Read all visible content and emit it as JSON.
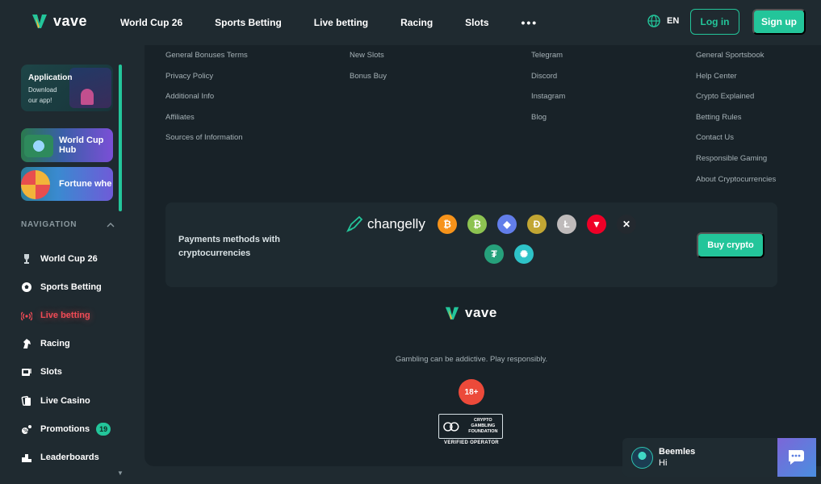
{
  "header": {
    "logo_text": "vave",
    "nav": [
      "World Cup 26",
      "Sports Betting",
      "Live betting",
      "Racing",
      "Slots"
    ],
    "more": "•••",
    "language": "EN",
    "login_label": "Log in",
    "signup_label": "Sign up"
  },
  "sidebar": {
    "promo_app": {
      "title": "Application",
      "subtitle": "Download our app!"
    },
    "promo_worldcup": {
      "title": "World Cup Hub"
    },
    "promo_fortune": {
      "title": "Fortune whe"
    },
    "nav_heading": "NAVIGATION",
    "nav_items": [
      {
        "label": "World Cup 26",
        "icon": "trophy-icon"
      },
      {
        "label": "Sports Betting",
        "icon": "soccer-ball-icon"
      },
      {
        "label": "Live betting",
        "icon": "live-broadcast-icon"
      },
      {
        "label": "Racing",
        "icon": "horse-icon"
      },
      {
        "label": "Slots",
        "icon": "slot-machine-icon"
      },
      {
        "label": "Live Casino",
        "icon": "cards-icon"
      },
      {
        "label": "Promotions",
        "icon": "gift-icon",
        "badge": "19"
      },
      {
        "label": "Leaderboards",
        "icon": "podium-icon"
      }
    ]
  },
  "footer": {
    "col1": [
      "General Bonuses Terms",
      "Privacy Policy",
      "Additional Info",
      "Affiliates",
      "Sources of Information"
    ],
    "col2": [
      "New Slots",
      "Bonus Buy"
    ],
    "col3": [
      "Telegram",
      "Discord",
      "Instagram",
      "Blog"
    ],
    "col4": [
      "General Sportsbook",
      "Help Center",
      "Crypto Explained",
      "Betting Rules",
      "Contact Us",
      "Responsible Gaming",
      "About Cryptocurrencies"
    ],
    "payments": {
      "text": "Payments methods with cryptocurrencies",
      "provider": "changelly",
      "buy_label": "Buy crypto",
      "coins": [
        {
          "symbol": "₿",
          "name": "bitcoin-icon",
          "color": "#f7931a"
        },
        {
          "symbol": "₿",
          "name": "bitcoin-cash-icon",
          "color": "#8dc351"
        },
        {
          "symbol": "◆",
          "name": "ethereum-icon",
          "color": "#627eea"
        },
        {
          "symbol": "Ð",
          "name": "dogecoin-icon",
          "color": "#c2a633"
        },
        {
          "symbol": "Ł",
          "name": "litecoin-icon",
          "color": "#bfbbbb"
        },
        {
          "symbol": "▼",
          "name": "tron-icon",
          "color": "#ef0027"
        },
        {
          "symbol": "✕",
          "name": "ripple-icon",
          "color": "#23292f"
        }
      ],
      "coins2": [
        {
          "symbol": "₮",
          "name": "tether-icon",
          "color": "#26a17b"
        },
        {
          "symbol": "✺",
          "name": "usdc-icon",
          "color": "#2ec3c8"
        }
      ]
    },
    "logo_text": "vave",
    "gambling_note": "Gambling can be addictive. Play responsibly.",
    "age_badge": "18+",
    "cgf_text": "CRYPTO GAMBLING FOUNDATION",
    "cgf_verified": "VERIFIED OPERATOR"
  },
  "chat": {
    "name": "Beemles",
    "message": "Hi"
  },
  "colors": {
    "accent": "#23c59a",
    "live": "#ef4b55",
    "background": "#1f2a30",
    "panel": "#182228"
  }
}
